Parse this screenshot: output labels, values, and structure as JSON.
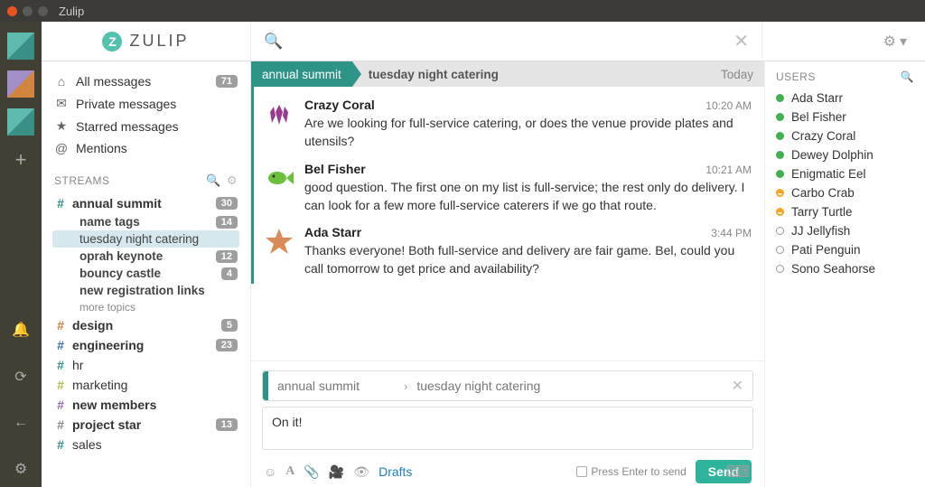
{
  "window": {
    "title": "Zulip"
  },
  "brand": "ZULIP",
  "search": {
    "placeholder": ""
  },
  "nav": {
    "all_messages": "All messages",
    "all_messages_badge": "71",
    "private": "Private messages",
    "starred": "Starred messages",
    "mentions": "Mentions"
  },
  "streams_label": "STREAMS",
  "streams": [
    {
      "name": "annual summit",
      "color": "#2e9488",
      "bold": true,
      "badge": "30",
      "topics": [
        {
          "name": "name tags",
          "bold": true,
          "badge": "14"
        },
        {
          "name": "tuesday night catering",
          "active": true
        },
        {
          "name": "oprah keynote",
          "bold": true,
          "badge": "12"
        },
        {
          "name": "bouncy castle",
          "bold": true,
          "badge": "4"
        },
        {
          "name": "new registration links",
          "bold": true
        }
      ],
      "more": "more topics"
    },
    {
      "name": "design",
      "color": "#d97b3d",
      "badge": "5",
      "bold": true
    },
    {
      "name": "engineering",
      "color": "#3b6fb5",
      "badge": "23",
      "bold": true
    },
    {
      "name": "hr",
      "color": "#2e9488"
    },
    {
      "name": "marketing",
      "color": "#b9be4a"
    },
    {
      "name": "new members",
      "color": "#8e6fae",
      "bold": true
    },
    {
      "name": "project star",
      "color": "#888",
      "badge": "13",
      "bold": true
    },
    {
      "name": "sales",
      "color": "#2e9488"
    }
  ],
  "thread": {
    "stream": "annual summit",
    "topic": "tuesday night catering",
    "date": "Today",
    "messages": [
      {
        "avatar": "coral",
        "name": "Crazy Coral",
        "time": "10:20 AM",
        "text": "Are we looking for full-service catering, or does the venue provide plates and utensils?"
      },
      {
        "avatar": "fish",
        "name": "Bel Fisher",
        "time": "10:21 AM",
        "text": "good question. The first one on my list is full-service; the rest only do delivery. I can look for a few more full-service caterers if we go that route."
      },
      {
        "avatar": "star",
        "name": "Ada Starr",
        "time": "3:44 PM",
        "text": "Thanks everyone! Both full-service and delivery are fair game. Bel, could you call tomorrow to get price and availability?"
      }
    ]
  },
  "compose": {
    "stream": "annual summit",
    "topic": "tuesday night catering",
    "body": "On it!",
    "drafts": "Drafts",
    "press_enter": "Press Enter to send",
    "send": "Send"
  },
  "users_label": "USERS",
  "users": [
    {
      "name": "Ada Starr",
      "status": "online"
    },
    {
      "name": "Bel Fisher",
      "status": "online"
    },
    {
      "name": "Crazy Coral",
      "status": "online"
    },
    {
      "name": "Dewey Dolphin",
      "status": "online"
    },
    {
      "name": "Enigmatic Eel",
      "status": "online"
    },
    {
      "name": "Carbo Crab",
      "status": "away"
    },
    {
      "name": "Tarry Turtle",
      "status": "away"
    },
    {
      "name": "JJ Jellyfish",
      "status": "offline"
    },
    {
      "name": "Pati Penguin",
      "status": "offline"
    },
    {
      "name": "Sono Seahorse",
      "status": "offline"
    }
  ]
}
